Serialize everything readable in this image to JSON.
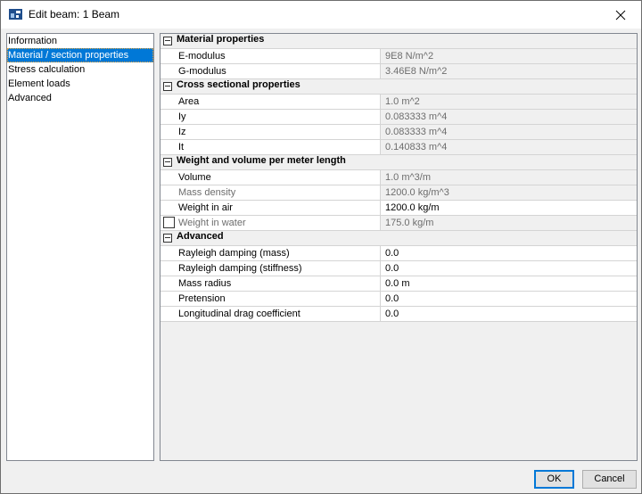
{
  "window": {
    "title": "Edit beam: 1 Beam",
    "icon": "app-icon",
    "close_icon": "close-icon"
  },
  "nav": {
    "items": [
      {
        "label": "Information",
        "selected": false
      },
      {
        "label": "Material / section properties",
        "selected": true
      },
      {
        "label": "Stress calculation",
        "selected": false
      },
      {
        "label": "Element loads",
        "selected": false
      },
      {
        "label": "Advanced",
        "selected": false
      }
    ]
  },
  "grid": {
    "sections": [
      {
        "title": "Material properties",
        "rows": [
          {
            "label": "E-modulus",
            "value": "9E8 N/m^2"
          },
          {
            "label": "G-modulus",
            "value": "3.46E8 N/m^2"
          }
        ]
      },
      {
        "title": "Cross sectional properties",
        "rows": [
          {
            "label": "Area",
            "value": "1.0 m^2"
          },
          {
            "label": "Iy",
            "value": "0.083333 m^4"
          },
          {
            "label": "Iz",
            "value": "0.083333 m^4"
          },
          {
            "label": "It",
            "value": "0.140833 m^4"
          }
        ]
      },
      {
        "title": "Weight and volume per meter length",
        "rows": [
          {
            "label": "Volume",
            "value": "1.0 m^3/m"
          },
          {
            "label": "Mass density",
            "value": "1200.0 kg/m^3"
          },
          {
            "label": "Weight in air",
            "value": "1200.0 kg/m"
          },
          {
            "label": "Weight in water",
            "value": "175.0 kg/m",
            "checkbox_checked": false
          }
        ]
      },
      {
        "title": "Advanced",
        "rows": [
          {
            "label": "Rayleigh damping (mass)",
            "value": "0.0"
          },
          {
            "label": "Rayleigh damping (stiffness)",
            "value": "0.0"
          },
          {
            "label": "Mass radius",
            "value": "0.0 m"
          },
          {
            "label": "Pretension",
            "value": "0.0"
          },
          {
            "label": "Longitudinal drag coefficient",
            "value": "0.0"
          }
        ]
      }
    ]
  },
  "buttons": {
    "ok": "OK",
    "cancel": "Cancel"
  }
}
